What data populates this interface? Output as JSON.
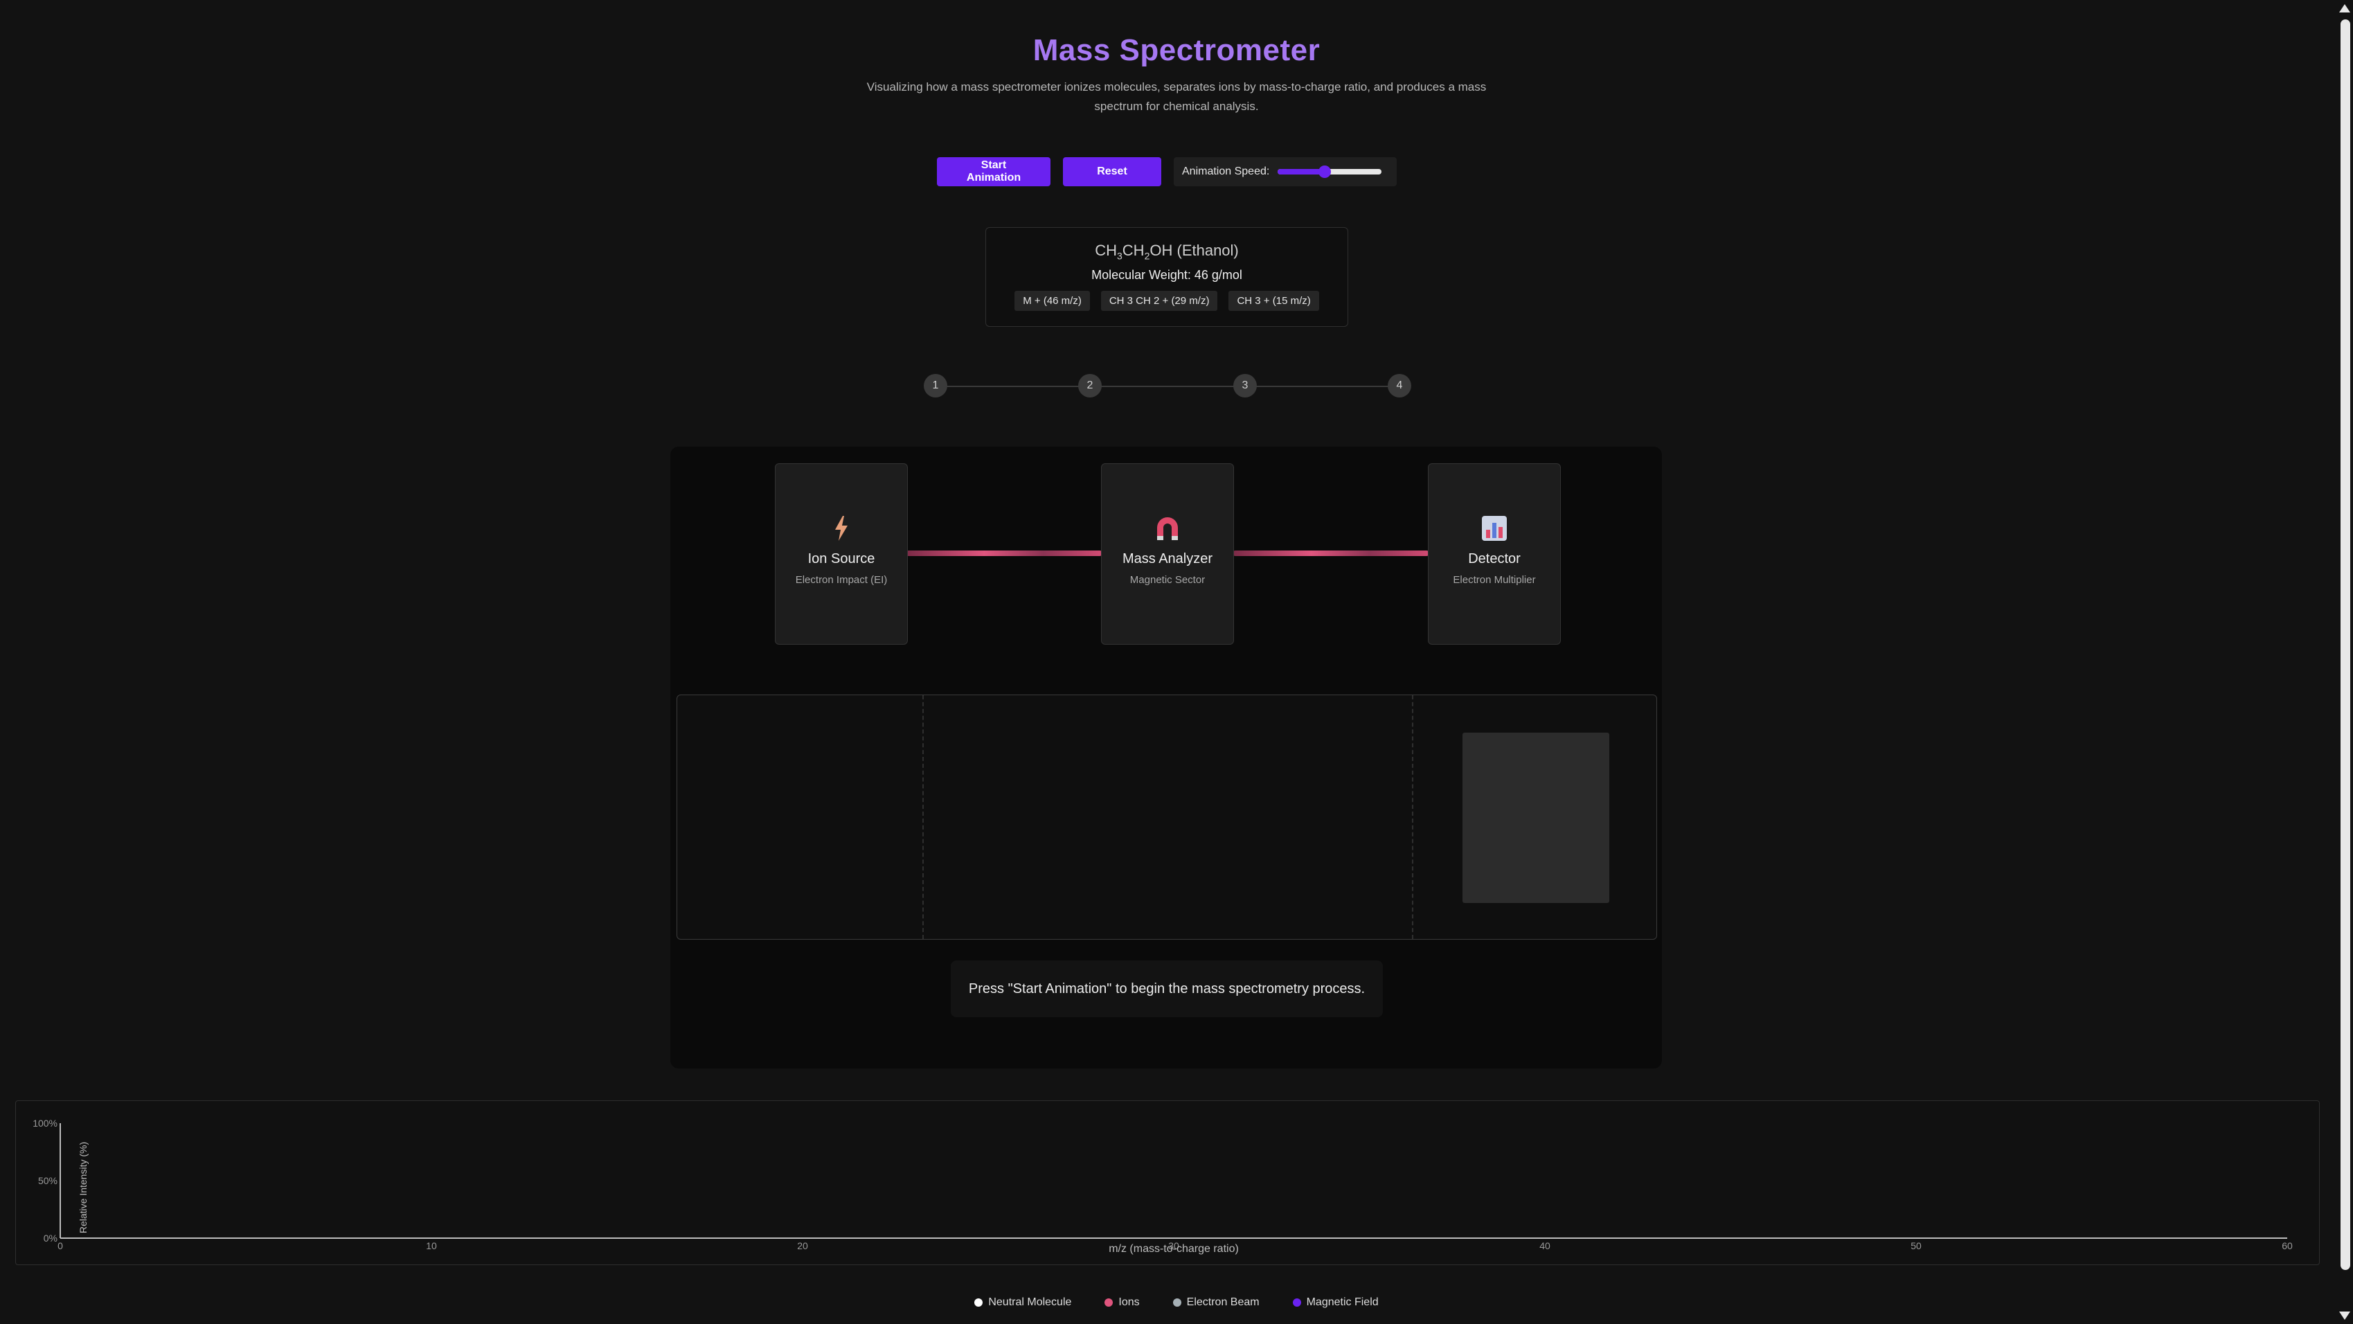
{
  "header": {
    "title": "Mass Spectrometer",
    "subtitle": "Visualizing how a mass spectrometer ionizes molecules, separates ions by mass-to-charge ratio, and produces a mass spectrum for chemical analysis."
  },
  "controls": {
    "start_label": "Start Animation",
    "reset_label": "Reset",
    "speed_label": "Animation Speed:",
    "speed_value": 0.45
  },
  "molecule": {
    "formula_parts": [
      "CH",
      "3",
      "CH",
      "2",
      "OH (Ethanol)"
    ],
    "weight": "Molecular Weight: 46 g/mol",
    "fragments": [
      "M + (46 m/z)",
      "CH 3 CH 2 + (29 m/z)",
      "CH 3 + (15 m/z)"
    ]
  },
  "steps": [
    "1",
    "2",
    "3",
    "4"
  ],
  "components": [
    {
      "name": "Ion Source",
      "sub": "Electron Impact (EI)",
      "icon": "lightning-icon"
    },
    {
      "name": "Mass Analyzer",
      "sub": "Magnetic Sector",
      "icon": "magnet-icon"
    },
    {
      "name": "Detector",
      "sub": "Electron Multiplier",
      "icon": "detector-icon"
    }
  ],
  "status": "Press \"Start Animation\" to begin the mass spectrometry process.",
  "chart_data": {
    "type": "bar",
    "x": [],
    "values": [],
    "xlabel": "m/z (mass-to-charge ratio)",
    "ylabel": "Relative Intensity (%)",
    "xlim": [
      0,
      60
    ],
    "ylim": [
      0,
      100
    ],
    "xticks": [
      "0",
      "10",
      "20",
      "30",
      "40",
      "50",
      "60"
    ],
    "yticks": [
      "0%",
      "50%",
      "100%"
    ]
  },
  "legend": [
    {
      "label": "Neutral Molecule",
      "color": "#ffffff"
    },
    {
      "label": "Ions",
      "color": "#e0557e"
    },
    {
      "label": "Electron Beam",
      "color": "#a6b0b6"
    },
    {
      "label": "Magnetic Field",
      "color": "#6a22f0"
    }
  ],
  "colors": {
    "accent": "#6a22f0",
    "title": "#a678f2",
    "beam": "#e0557e"
  }
}
